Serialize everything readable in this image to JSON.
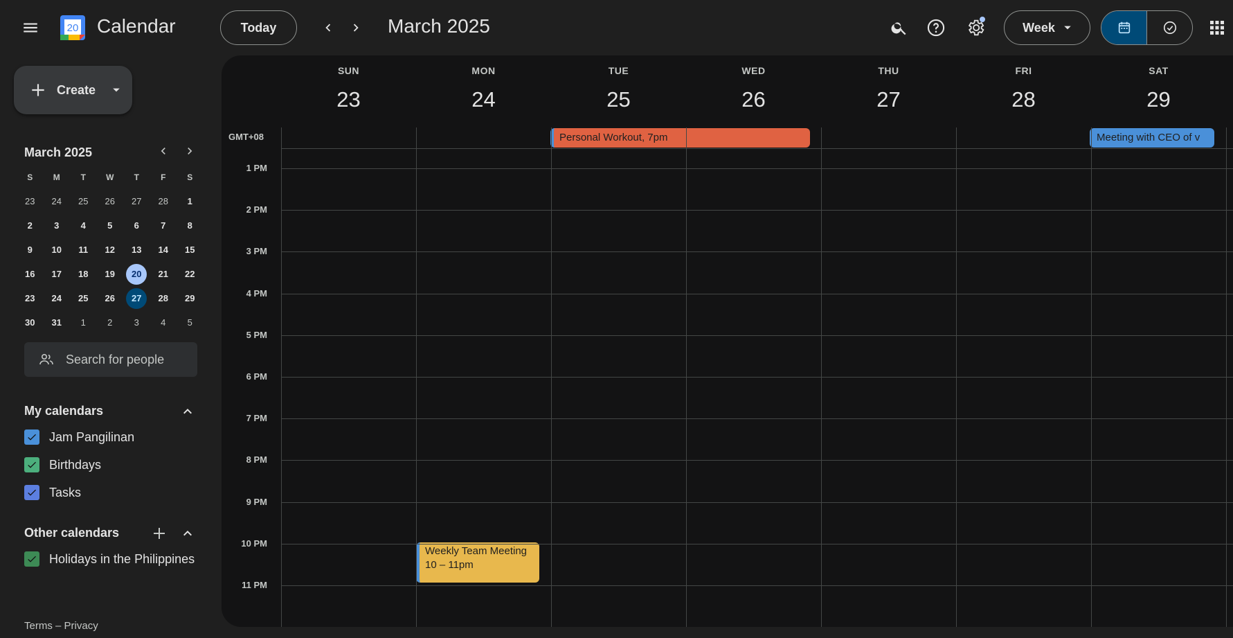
{
  "app": {
    "title": "Calendar",
    "logo_number": "20"
  },
  "toolbar": {
    "today_label": "Today",
    "month_title": "March 2025",
    "view_label": "Week"
  },
  "sidebar": {
    "create_label": "Create",
    "mini_month": "March 2025",
    "dow": [
      "S",
      "M",
      "T",
      "W",
      "T",
      "F",
      "S"
    ],
    "weeks": [
      [
        "23",
        "24",
        "25",
        "26",
        "27",
        "28",
        "1"
      ],
      [
        "2",
        "3",
        "4",
        "5",
        "6",
        "7",
        "8"
      ],
      [
        "9",
        "10",
        "11",
        "12",
        "13",
        "14",
        "15"
      ],
      [
        "16",
        "17",
        "18",
        "19",
        "20",
        "21",
        "22"
      ],
      [
        "23",
        "24",
        "25",
        "26",
        "27",
        "28",
        "29"
      ],
      [
        "30",
        "31",
        "1",
        "2",
        "3",
        "4",
        "5"
      ]
    ],
    "search_people_placeholder": "Search for people",
    "my_calendars_label": "My calendars",
    "my_calendars": [
      {
        "name": "Jam Pangilinan",
        "color": "#4a90d9"
      },
      {
        "name": "Birthdays",
        "color": "#4caf7d"
      },
      {
        "name": "Tasks",
        "color": "#5c7fe0"
      }
    ],
    "other_calendars_label": "Other calendars",
    "other_calendars": [
      {
        "name": "Holidays in the Philippines",
        "color": "#3d8a55"
      }
    ],
    "footer_terms": "Terms",
    "footer_sep": "–",
    "footer_privacy": "Privacy"
  },
  "week": {
    "timezone": "GMT+08",
    "days": [
      {
        "dow": "SUN",
        "num": "23"
      },
      {
        "dow": "MON",
        "num": "24"
      },
      {
        "dow": "TUE",
        "num": "25"
      },
      {
        "dow": "WED",
        "num": "26"
      },
      {
        "dow": "THU",
        "num": "27"
      },
      {
        "dow": "FRI",
        "num": "28"
      },
      {
        "dow": "SAT",
        "num": "29"
      }
    ],
    "hours": [
      "1 PM",
      "2 PM",
      "3 PM",
      "4 PM",
      "5 PM",
      "6 PM",
      "7 PM",
      "8 PM",
      "9 PM",
      "10 PM",
      "11 PM"
    ]
  },
  "events": {
    "workout": {
      "title": "Personal Workout,",
      "time": "7pm"
    },
    "ceo": {
      "title": "Meeting with CEO of v"
    },
    "team": {
      "title": "Weekly Team Meeting",
      "time": "10 – 11pm"
    }
  },
  "colors": {
    "accent": "#a8c7fa",
    "today": "#004a77",
    "workout": "#e06242",
    "meeting": "#e8b84d",
    "ceo": "#4a90d9"
  }
}
